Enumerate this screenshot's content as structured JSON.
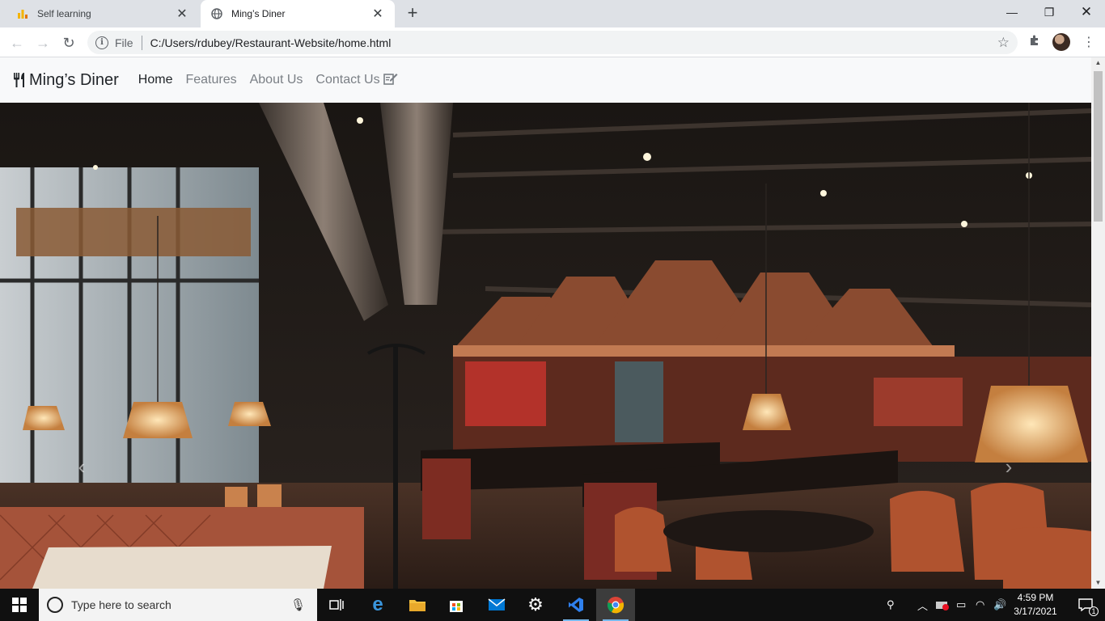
{
  "browser": {
    "tabs": [
      {
        "title": "Self learning",
        "favicon": "chart-icon",
        "active": false
      },
      {
        "title": "Ming’s Diner",
        "favicon": "globe-icon",
        "active": true
      }
    ],
    "address": {
      "scheme_label": "File",
      "url": "C:/Users/rdubey/Restaurant-Website/home.html"
    }
  },
  "site": {
    "brand": "Ming’s Diner",
    "brand_icon": "utensils-icon",
    "nav": [
      {
        "label": "Home",
        "active": true
      },
      {
        "label": "Features",
        "active": false
      },
      {
        "label": "About Us",
        "active": false
      },
      {
        "label": "Contact Us",
        "active": false
      }
    ],
    "contact_icon": "edit-icon",
    "carousel": {
      "image": "restaurant-interior-photo",
      "prev_icon": "chevron-left-icon",
      "next_icon": "chevron-right-icon"
    }
  },
  "taskbar": {
    "search_placeholder": "Type here to search",
    "pinned_icons": [
      "task-view-icon",
      "edge-icon",
      "file-explorer-icon",
      "store-icon",
      "mail-icon",
      "settings-icon",
      "vscode-icon",
      "chrome-icon"
    ],
    "time": "4:59 PM",
    "date": "3/17/2021",
    "notification_count": "1"
  },
  "colors": {
    "tabstrip": "#dee1e6",
    "site_nav_bg": "#f8f9fa",
    "taskbar": "#101010"
  }
}
